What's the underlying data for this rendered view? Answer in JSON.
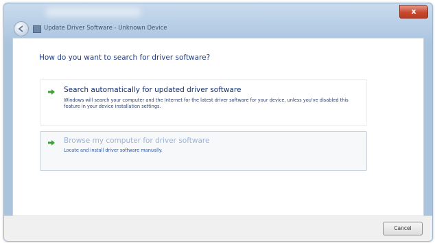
{
  "window": {
    "title": "Update Driver Software - Unknown Device",
    "close_label": "x"
  },
  "main": {
    "heading": "How do you want to search for driver software?",
    "options": [
      {
        "title": "Search automatically for updated driver software",
        "description": "Windows will search your computer and the Internet for the latest driver software for your device, unless you've disabled this feature in your device installation settings."
      },
      {
        "title": "Browse my computer for driver software",
        "description": "Locate and install driver software manually."
      }
    ]
  },
  "footer": {
    "cancel_label": "Cancel"
  },
  "colors": {
    "arrow": "#3aa335",
    "heading": "#1f3c88"
  }
}
